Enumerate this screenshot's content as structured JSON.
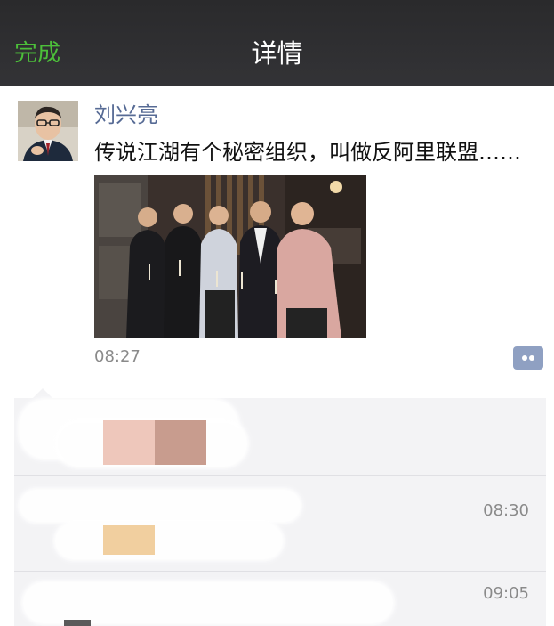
{
  "nav": {
    "back_label": "完成",
    "title": "详情"
  },
  "post": {
    "author": "刘兴亮",
    "text": "传说江湖有个秘密组织，叫做反阿里联盟……",
    "time": "08:27",
    "comment_icon": "comment-bubble-icon"
  },
  "comments": [
    {
      "time": ""
    },
    {
      "time": "08:30"
    },
    {
      "time": "09:05"
    }
  ],
  "colors": {
    "nav_bg": "#2f2f31",
    "accent_green": "#4cbf3a",
    "author_link": "#576b95",
    "panel_bg": "#f3f3f5"
  }
}
